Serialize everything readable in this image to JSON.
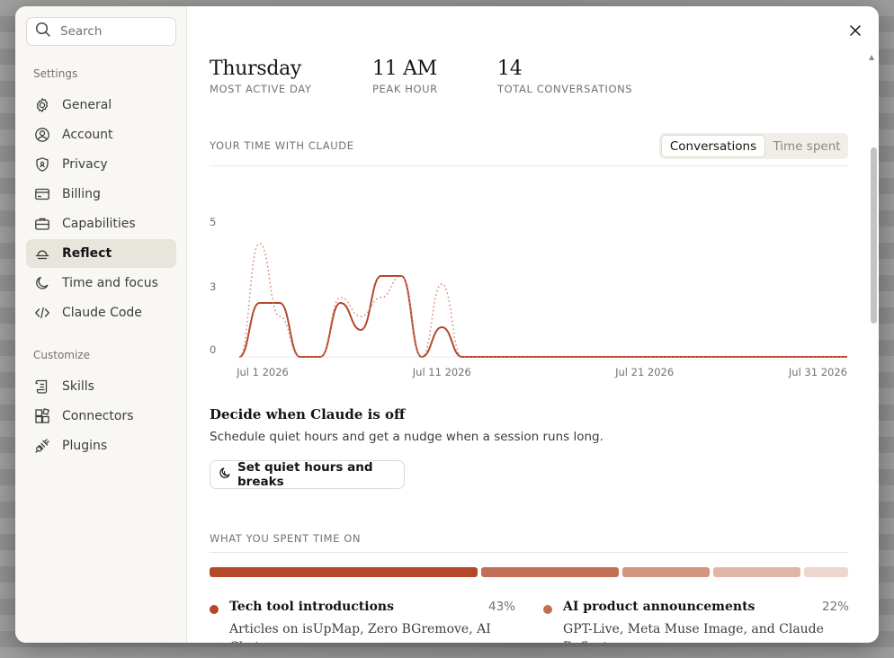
{
  "search": {
    "placeholder": "Search"
  },
  "sidebar": {
    "settings_label": "Settings",
    "settings_items": [
      {
        "label": "General",
        "icon": "gear-icon"
      },
      {
        "label": "Account",
        "icon": "user-circle-icon"
      },
      {
        "label": "Privacy",
        "icon": "shield-icon"
      },
      {
        "label": "Billing",
        "icon": "card-icon"
      },
      {
        "label": "Capabilities",
        "icon": "briefcase-icon"
      },
      {
        "label": "Reflect",
        "icon": "sunset-icon",
        "active": true
      },
      {
        "label": "Time and focus",
        "icon": "moon-icon"
      },
      {
        "label": "Claude Code",
        "icon": "code-icon"
      }
    ],
    "customize_label": "Customize",
    "customize_items": [
      {
        "label": "Skills",
        "icon": "scroll-icon"
      },
      {
        "label": "Connectors",
        "icon": "blocks-icon"
      },
      {
        "label": "Plugins",
        "icon": "plug-icon"
      }
    ]
  },
  "stats": [
    {
      "value": "Thursday",
      "label": "MOST ACTIVE DAY"
    },
    {
      "value": "11 AM",
      "label": "PEAK HOUR"
    },
    {
      "value": "14",
      "label": "TOTAL CONVERSATIONS"
    }
  ],
  "time_section": {
    "heading": "YOUR TIME WITH CLAUDE",
    "toggle": {
      "options": [
        "Conversations",
        "Time spent"
      ],
      "selected": "Conversations"
    }
  },
  "chart_data": {
    "type": "line",
    "x_ticks": [
      "Jul 1 2026",
      "Jul 11 2026",
      "Jul 21 2026",
      "Jul 31 2026"
    ],
    "y_ticks": [
      "0",
      "3",
      "5"
    ],
    "ylim": [
      0,
      5
    ],
    "x": [
      1,
      2,
      3,
      4,
      5,
      6,
      7,
      8,
      9,
      10,
      11,
      12,
      13,
      14,
      15,
      16,
      17,
      18,
      19,
      20,
      21,
      22,
      23,
      24,
      25,
      26,
      27,
      28,
      29,
      30,
      31
    ],
    "series": [
      {
        "style": "solid",
        "color": "#b5472a",
        "values": [
          0,
          2,
          2,
          0,
          0,
          2,
          1,
          3,
          3,
          0,
          1.1,
          0,
          0,
          0,
          0,
          0,
          0,
          0,
          0,
          0,
          0,
          0,
          0,
          0,
          0,
          0,
          0,
          0,
          0,
          0,
          0
        ]
      },
      {
        "style": "dotted",
        "color": "#d07a66",
        "values": [
          0,
          4.2,
          1.5,
          0,
          0,
          2.2,
          1.5,
          2.2,
          3,
          0,
          2.7,
          0,
          0,
          0,
          0,
          0,
          0,
          0,
          0,
          0,
          0,
          0,
          0,
          0,
          0,
          0,
          0,
          0,
          0,
          0,
          0
        ]
      }
    ]
  },
  "decide": {
    "title": "Decide when Claude is off",
    "description": "Schedule quiet hours and get a nudge when a session runs long.",
    "button_label": "Set quiet hours and breaks"
  },
  "spent_section": {
    "heading": "WHAT YOU SPENT TIME ON",
    "bar": [
      {
        "fraction": 0.43,
        "color": "#b5472a"
      },
      {
        "fraction": 0.22,
        "color": "#c46e55"
      },
      {
        "fraction": 0.14,
        "color": "#d3957f"
      },
      {
        "fraction": 0.14,
        "color": "#e2b5a6"
      },
      {
        "fraction": 0.07,
        "color": "#ecd6cd"
      }
    ],
    "topics": [
      {
        "name": "Tech tool introductions",
        "percent": "43%",
        "color": "#b5472a",
        "description": "Articles on isUpMap, Zero BGremove, AI Chat"
      },
      {
        "name": "AI product announcements",
        "percent": "22%",
        "color": "#c46e55",
        "description": "GPT-Live, Meta Muse Image, and Claude Reflect"
      }
    ]
  }
}
